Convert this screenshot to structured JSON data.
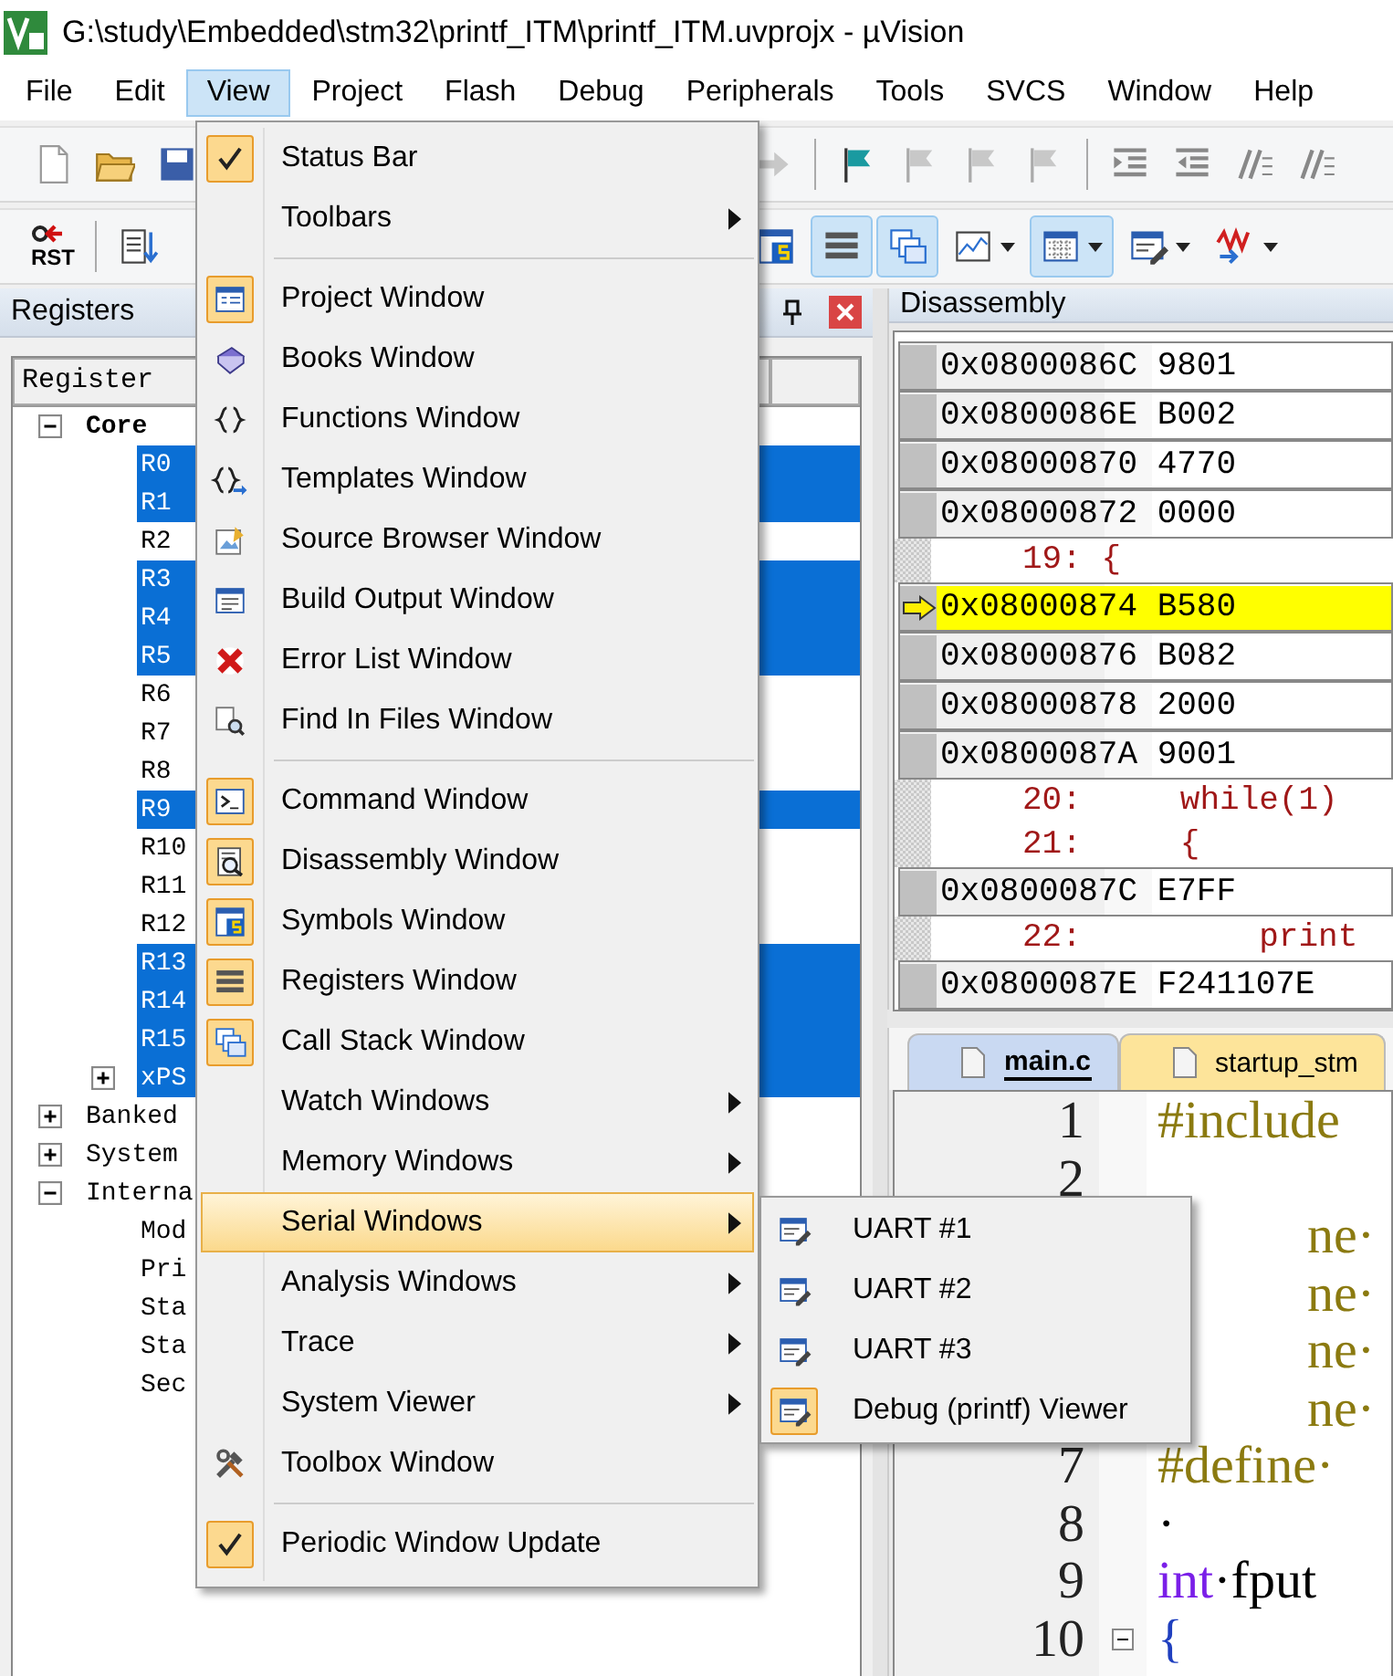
{
  "window": {
    "title": "G:\\study\\Embedded\\stm32\\printf_ITM\\printf_ITM.uvprojx - µVision"
  },
  "menu_bar": [
    {
      "label": "File",
      "selected": false
    },
    {
      "label": "Edit",
      "selected": false
    },
    {
      "label": "View",
      "selected": true
    },
    {
      "label": "Project",
      "selected": false
    },
    {
      "label": "Flash",
      "selected": false
    },
    {
      "label": "Debug",
      "selected": false
    },
    {
      "label": "Peripherals",
      "selected": false
    },
    {
      "label": "Tools",
      "selected": false
    },
    {
      "label": "SVCS",
      "selected": false
    },
    {
      "label": "Window",
      "selected": false
    },
    {
      "label": "Help",
      "selected": false
    }
  ],
  "toolbar_2": {
    "reset_label": "RST",
    "buttons": [
      {
        "pressed": false
      },
      {
        "pressed": true
      },
      {
        "pressed": true
      },
      {
        "pressed": false
      },
      {
        "pressed": true
      },
      {
        "pressed": false
      },
      {
        "pressed": false
      }
    ]
  },
  "registers_panel": {
    "title": "Registers",
    "column_header": "Register",
    "tree": [
      {
        "label": "Core",
        "bold": true,
        "selected": false,
        "expanded": true,
        "children": [
          {
            "label": "R0",
            "selected": true
          },
          {
            "label": "R1",
            "selected": true
          },
          {
            "label": "R2",
            "selected": false
          },
          {
            "label": "R3",
            "selected": true
          },
          {
            "label": "R4",
            "selected": true
          },
          {
            "label": "R5",
            "selected": true
          },
          {
            "label": "R6",
            "selected": false
          },
          {
            "label": "R7",
            "selected": false
          },
          {
            "label": "R8",
            "selected": false
          },
          {
            "label": "R9",
            "selected": true
          },
          {
            "label": "R10",
            "selected": false
          },
          {
            "label": "R11",
            "selected": false
          },
          {
            "label": "R12",
            "selected": false
          },
          {
            "label": "R13",
            "selected": true
          },
          {
            "label": "R14",
            "selected": true
          },
          {
            "label": "R15",
            "selected": true
          },
          {
            "label": "xPS",
            "selected": true,
            "expanded": false
          }
        ]
      },
      {
        "label": "Banked",
        "bold": false,
        "selected": false,
        "expanded": false
      },
      {
        "label": "System",
        "bold": false,
        "selected": false,
        "expanded": false
      },
      {
        "label": "Interna",
        "bold": false,
        "selected": false,
        "expanded": true,
        "children": [
          {
            "label": "Mod",
            "selected": false
          },
          {
            "label": "Pri",
            "selected": false
          },
          {
            "label": "Sta",
            "selected": false
          },
          {
            "label": "Sta",
            "selected": false
          },
          {
            "label": "Sec",
            "selected": false
          }
        ]
      }
    ]
  },
  "disassembly": {
    "title": "Disassembly",
    "rows": [
      {
        "kind": "code",
        "text": "0x0800086C 9801",
        "current": false
      },
      {
        "kind": "code",
        "text": "0x0800086E B002",
        "current": false
      },
      {
        "kind": "code",
        "text": "0x08000870 4770",
        "current": false
      },
      {
        "kind": "code",
        "text": "0x08000872 0000",
        "current": false
      },
      {
        "kind": "source",
        "text": "19: {",
        "current": false
      },
      {
        "kind": "code",
        "text": "0x08000874 B580",
        "current": true
      },
      {
        "kind": "code",
        "text": "0x08000876 B082",
        "current": false
      },
      {
        "kind": "code",
        "text": "0x08000878 2000",
        "current": false
      },
      {
        "kind": "code",
        "text": "0x0800087A 9001",
        "current": false
      },
      {
        "kind": "source",
        "text": "20:     while(1)",
        "current": false
      },
      {
        "kind": "source",
        "text": "21:     {",
        "current": false
      },
      {
        "kind": "code",
        "text": "0x0800087C E7FF",
        "current": false
      },
      {
        "kind": "source",
        "text": "22:         print",
        "current": false
      },
      {
        "kind": "code",
        "text": "0x0800087E F241107E",
        "current": false
      }
    ]
  },
  "editor": {
    "tabs": [
      {
        "label": "main.c",
        "selected": true
      },
      {
        "label": "startup_stm",
        "selected": false
      }
    ],
    "lines": [
      {
        "number": "1",
        "kind": "full",
        "tokens": [
          {
            "text": "#include",
            "kind": "directive"
          }
        ]
      },
      {
        "number": "2",
        "kind": "full"
      },
      {
        "kind": "partial",
        "tokens": [
          {
            "text": "ne·",
            "kind": "directive"
          }
        ]
      },
      {
        "kind": "partial",
        "tokens": [
          {
            "text": "ne·",
            "kind": "directive"
          }
        ]
      },
      {
        "kind": "partial",
        "tokens": [
          {
            "text": "ne·",
            "kind": "directive"
          }
        ]
      },
      {
        "kind": "partial",
        "tokens": [
          {
            "text": "ne·",
            "kind": "directive"
          }
        ]
      },
      {
        "number": "7",
        "kind": "full",
        "tokens": [
          {
            "text": "#define·",
            "kind": "directive"
          }
        ]
      },
      {
        "number": "8",
        "kind": "full",
        "tokens": [
          {
            "text": "·",
            "kind": "plain"
          }
        ]
      },
      {
        "number": "9",
        "kind": "full",
        "tokens": [
          {
            "text": "int",
            "kind": "keyword"
          },
          {
            "text": "·fput",
            "kind": "plain"
          }
        ]
      },
      {
        "number": "10",
        "kind": "fold",
        "tokens": [
          {
            "text": "{",
            "kind": "brace"
          }
        ]
      }
    ]
  },
  "view_menu": {
    "items": [
      {
        "label": "Status Bar",
        "kind": "check",
        "checked": true,
        "selected": false
      },
      {
        "label": "Toolbars",
        "kind": "submenu",
        "selected": false
      },
      {
        "kind": "separator"
      },
      {
        "label": "Project Window",
        "kind": "window",
        "checked": true,
        "selected": false
      },
      {
        "label": "Books Window",
        "kind": "window",
        "checked": false,
        "selected": false
      },
      {
        "label": "Functions Window",
        "kind": "window",
        "checked": false,
        "selected": false
      },
      {
        "label": "Templates Window",
        "kind": "window",
        "checked": false,
        "selected": false
      },
      {
        "label": "Source Browser Window",
        "kind": "window",
        "checked": false,
        "selected": false
      },
      {
        "label": "Build Output Window",
        "kind": "window",
        "checked": false,
        "selected": false
      },
      {
        "label": "Error List Window",
        "kind": "window",
        "checked": false,
        "selected": false
      },
      {
        "label": "Find In Files Window",
        "kind": "window",
        "checked": false,
        "selected": false
      },
      {
        "kind": "separator"
      },
      {
        "label": "Command Window",
        "kind": "window",
        "checked": true,
        "selected": false
      },
      {
        "label": "Disassembly Window",
        "kind": "window",
        "checked": true,
        "selected": false
      },
      {
        "label": "Symbols Window",
        "kind": "window",
        "checked": true,
        "selected": false
      },
      {
        "label": "Registers Window",
        "kind": "window",
        "checked": true,
        "selected": false
      },
      {
        "label": "Call Stack Window",
        "kind": "window",
        "checked": true,
        "selected": false
      },
      {
        "label": "Watch Windows",
        "kind": "submenu",
        "selected": false
      },
      {
        "label": "Memory Windows",
        "kind": "submenu",
        "selected": false
      },
      {
        "label": "Serial Windows",
        "kind": "submenu",
        "selected": true
      },
      {
        "label": "Analysis Windows",
        "kind": "submenu",
        "selected": false
      },
      {
        "label": "Trace",
        "kind": "submenu",
        "selected": false
      },
      {
        "label": "System Viewer",
        "kind": "submenu",
        "selected": false
      },
      {
        "label": "Toolbox Window",
        "kind": "window",
        "checked": false,
        "selected": false
      },
      {
        "kind": "separator"
      },
      {
        "label": "Periodic Window Update",
        "kind": "check",
        "checked": true,
        "selected": false
      }
    ]
  },
  "serial_submenu": {
    "items": [
      {
        "label": "UART #1",
        "checked": false
      },
      {
        "label": "UART #2",
        "checked": false
      },
      {
        "label": "UART #3",
        "checked": false
      },
      {
        "label": "Debug (printf) Viewer",
        "checked": true
      }
    ]
  }
}
